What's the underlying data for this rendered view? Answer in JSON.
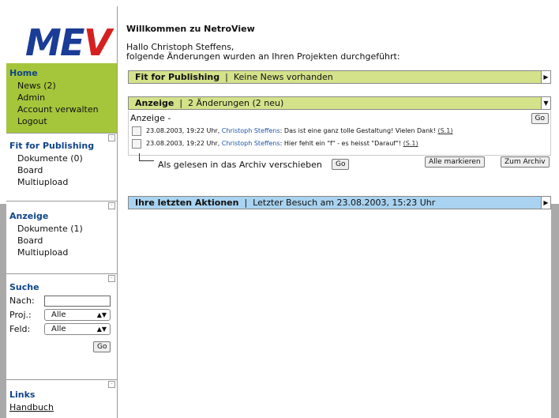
{
  "sidebar": {
    "logo": {
      "l1": "M",
      "l2": "E",
      "l3": "V"
    },
    "home": {
      "heading": "Home",
      "items": [
        "News (2)",
        "Admin",
        "Account verwalten",
        "Logout"
      ]
    },
    "fit": {
      "heading": "Fit for Publishing",
      "items": [
        "Dokumente (0)",
        "Board",
        "Multiupload"
      ]
    },
    "anzeige": {
      "heading": "Anzeige",
      "items": [
        "Dokumente (1)",
        "Board",
        "Multiupload"
      ]
    },
    "search": {
      "heading": "Suche",
      "nach_label": "Nach:",
      "proj_label": "Proj.:",
      "proj_value": "Alle",
      "feld_label": "Feld:",
      "feld_value": "Alle",
      "go": "Go"
    },
    "links": {
      "heading": "Links",
      "items": [
        "Handbuch"
      ]
    }
  },
  "main": {
    "title": "Willkommen zu NetroView",
    "greeting_line1": "Hallo Christoph Steffens,",
    "greeting_line2": "folgende Änderungen wurden an Ihren Projekten durchgeführt:",
    "bar1": {
      "name": "Fit for Publishing",
      "sep": "|",
      "info": "Keine News vorhanden"
    },
    "bar2": {
      "name": "Anzeige",
      "sep": "|",
      "info": "2 Änderungen (2 neu)"
    },
    "panel": {
      "label": "Anzeige -",
      "go": "Go",
      "entries": [
        {
          "date": "23.08.2003, 19:22 Uhr,",
          "author": "Christoph Steffens",
          "text": ": Das ist eine ganz tolle Gestaltung! Vielen Dank!",
          "ref": "(S.1)"
        },
        {
          "date": "23.08.2003, 19:22 Uhr,",
          "author": "Christoph Steffens",
          "text": ": Hier fehlt ein \"f\" - es heisst \"Darauf\"!",
          "ref": "(S.1)"
        }
      ]
    },
    "archive": {
      "text": "Als gelesen in das Archiv verschieben",
      "go": "Go",
      "mark_all": "Alle markieren",
      "to_archive": "Zum Archiv"
    },
    "bar3": {
      "name": "Ihre letzten Aktionen",
      "sep": "|",
      "info": "Letzter Besuch am 23.08.2003, 15:23 Uhr"
    }
  },
  "colors": {
    "accent_green": "#a5c63b",
    "bar_green": "#d4e28a",
    "bar_blue": "#a9d3f0",
    "link_blue": "#1f55a8",
    "heading_blue": "#114488"
  }
}
